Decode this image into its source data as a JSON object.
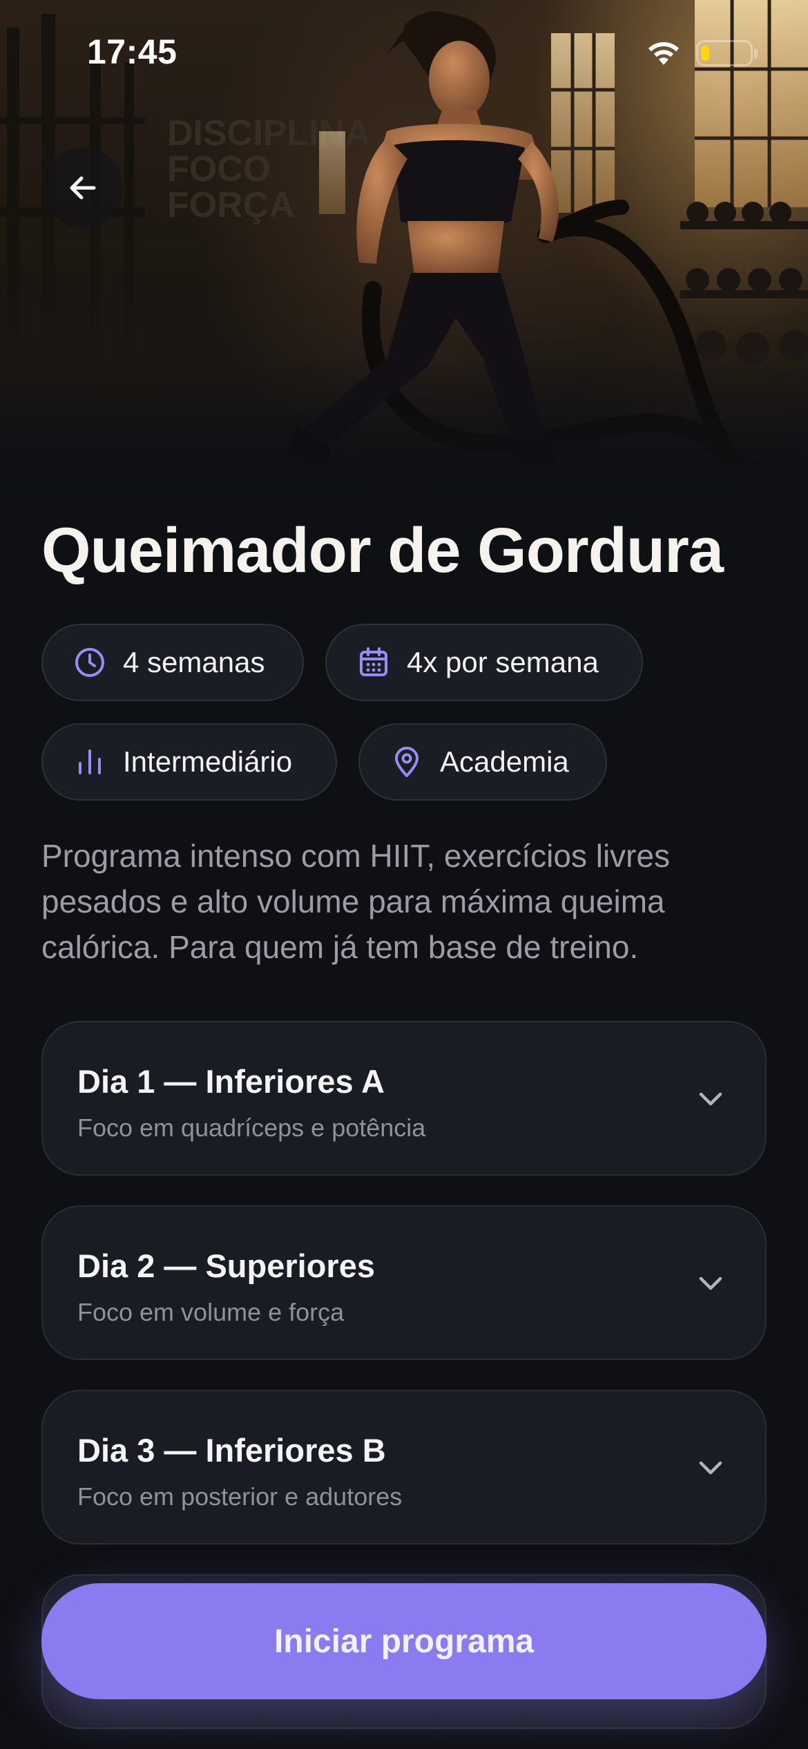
{
  "status_bar": {
    "time": "17:45",
    "wifi_icon": "wifi-icon",
    "battery_icon": "battery-icon",
    "battery_level": 0.18,
    "battery_color": "#ffd60a"
  },
  "hero": {
    "image_icon": "athlete-battle-ropes-photo",
    "back_icon": "arrow-left-icon",
    "wall_text": [
      "DISCIPLINA",
      "FOCO",
      "FORÇA"
    ]
  },
  "program": {
    "title": "Queimador de Gordura",
    "description": "Programa intenso com HIIT, exercícios livres pesados e alto volume para máxima queima calórica. Para quem já tem base de treino."
  },
  "chips": [
    {
      "icon": "clock-icon",
      "label": "4 semanas"
    },
    {
      "icon": "calendar-icon",
      "label": "4x por semana"
    },
    {
      "icon": "bar-chart-icon",
      "label": "Intermediário"
    },
    {
      "icon": "location-pin-icon",
      "label": "Academia"
    }
  ],
  "days": [
    {
      "title": "Dia 1 — Inferiores A",
      "subtitle": "Foco em quadríceps e potência",
      "icon": "chevron-down-icon"
    },
    {
      "title": "Dia 2 — Superiores",
      "subtitle": "Foco em volume e força",
      "icon": "chevron-down-icon"
    },
    {
      "title": "Dia 3 — Inferiores B",
      "subtitle": "Foco em posterior e adutores",
      "icon": "chevron-down-icon"
    }
  ],
  "cta": {
    "label": "Iniciar programa"
  },
  "colors": {
    "background": "#0f1014",
    "accent": "#8a7cf0",
    "chip_background": "#1b1d25",
    "card_background": "#1a1c24",
    "muted_text": "#9a9ca6"
  }
}
